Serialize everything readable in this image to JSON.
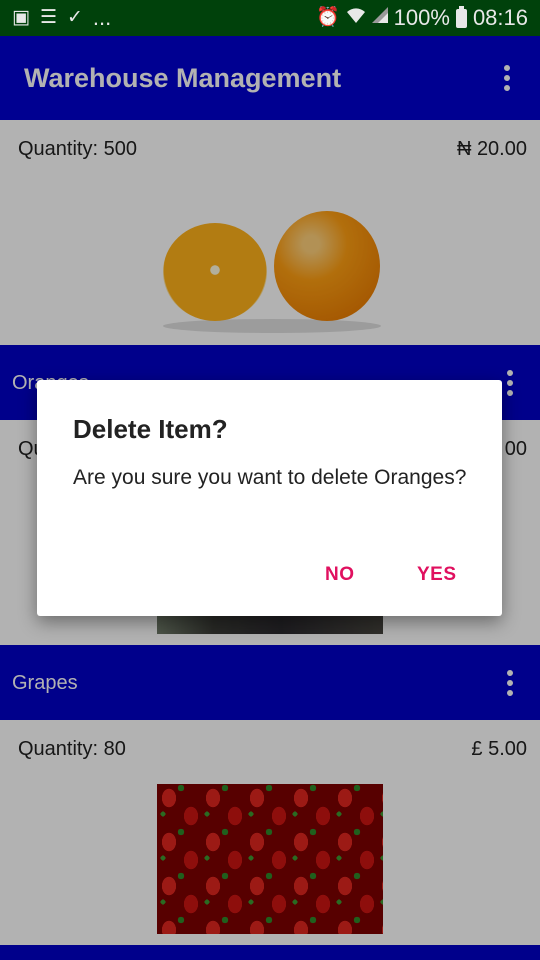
{
  "status_bar": {
    "icons": [
      "image-icon",
      "list-icon",
      "check-icon",
      "alarm-icon",
      "wifi-icon",
      "signal-icon",
      "battery-icon"
    ],
    "ellipsis": "...",
    "battery": "100%",
    "time": "08:16"
  },
  "app_bar": {
    "title": "Warehouse Management",
    "menu_icon": "more-vert-icon"
  },
  "items": [
    {
      "name": "",
      "quantity": "Quantity: 500",
      "price": "₦ 20.00",
      "image": "oranges"
    },
    {
      "name": "Oranges",
      "quantity": "Qu",
      "price": "00",
      "image": "dark-photo"
    },
    {
      "name": "Grapes",
      "quantity": "Quantity: 80",
      "price": "£ 5.00",
      "image": "strawberries"
    }
  ],
  "dialog": {
    "title": "Delete Item?",
    "message": "Are you sure you want to delete Oranges?",
    "negative_label": "NO",
    "positive_label": "YES"
  },
  "colors": {
    "status_bar": "#00410b",
    "app_bar": "#0000d0",
    "item_header": "#0000c8",
    "dialog_button": "#e0105f"
  }
}
